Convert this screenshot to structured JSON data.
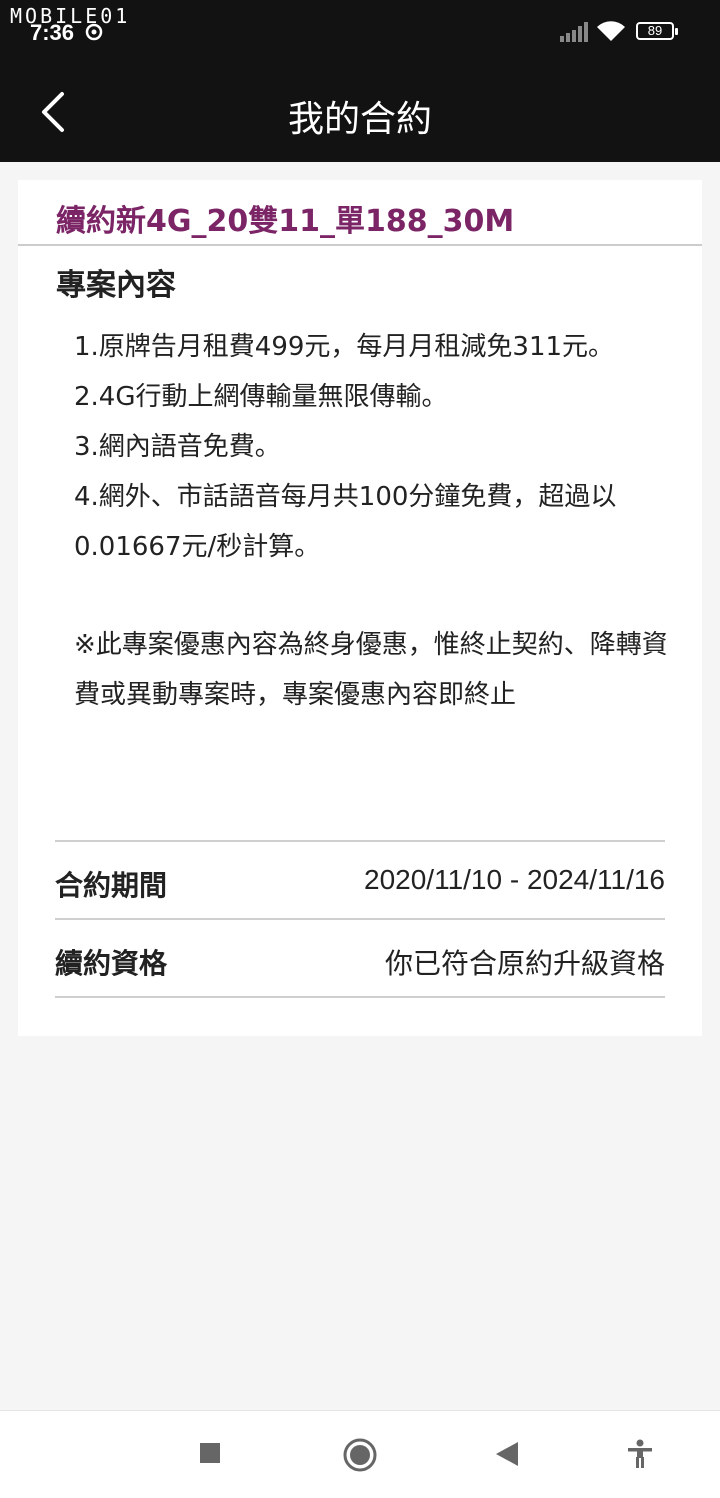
{
  "status_bar": {
    "watermark": "MOBILE01",
    "time": "7:36",
    "battery": "89"
  },
  "header": {
    "title": "我的合約",
    "back_icon": "chevron-left-icon"
  },
  "plan": {
    "name": "續約新4G_20雙11_單188_30M",
    "section_title": "專案內容",
    "content_lines": [
      "1.原牌告月租費499元，每月月租減免311元。",
      "2.4G行動上網傳輸量無限傳輸。",
      "3.網內語音免費。",
      "4.網外、市話語音每月共100分鐘免費，超過以0.01667元/秒計算。"
    ],
    "notice": "※此專案優惠內容為終身優惠，惟終止契約、降轉資費或異動專案時，專案優惠內容即終止"
  },
  "details": [
    {
      "label": "合約期間",
      "value": "2020/11/10 - 2024/11/16"
    },
    {
      "label": "續約資格",
      "value": "你已符合原約升級資格"
    }
  ],
  "colors": {
    "accent": "#7b2466",
    "header_bg": "#121212",
    "page_bg": "#f5f5f5"
  },
  "nav_bar": {
    "icons": [
      "square-icon",
      "home-circle-icon",
      "back-triangle-icon",
      "accessibility-icon"
    ]
  }
}
